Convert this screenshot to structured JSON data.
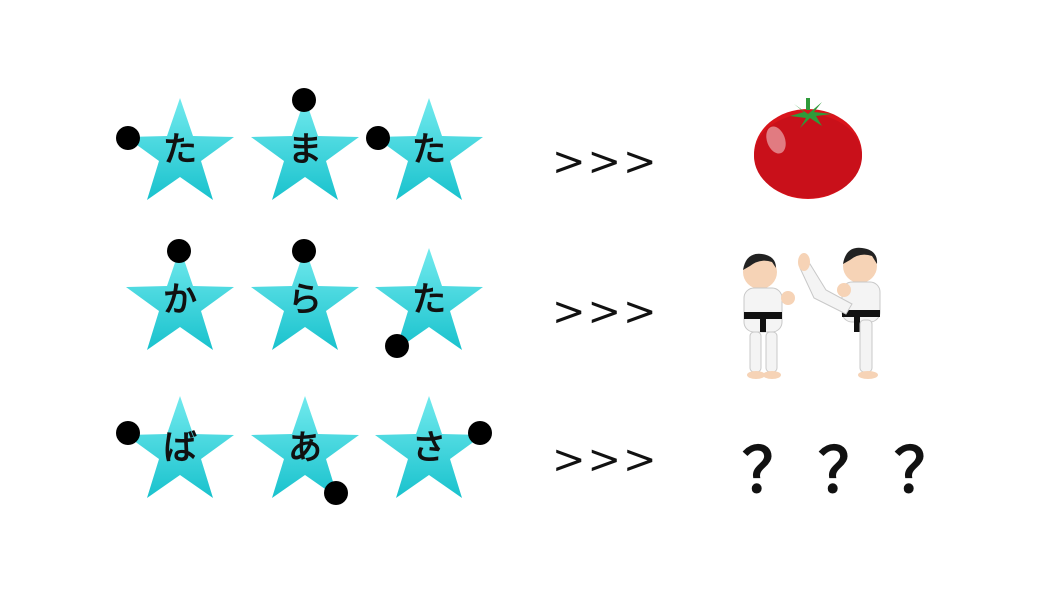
{
  "rows": [
    {
      "stars": [
        {
          "char": "た",
          "dot": "left"
        },
        {
          "char": "ま",
          "dot": "top"
        },
        {
          "char": "た",
          "dot": "left"
        }
      ],
      "arrow": ">>>",
      "answer_icon": "tomato-icon"
    },
    {
      "stars": [
        {
          "char": "か",
          "dot": "top"
        },
        {
          "char": "ら",
          "dot": "top"
        },
        {
          "char": "た",
          "dot": "bottom-left"
        }
      ],
      "arrow": ">>>",
      "answer_icon": "karate-fighters-icon"
    },
    {
      "stars": [
        {
          "char": "ば",
          "dot": "left"
        },
        {
          "char": "あ",
          "dot": "bottom-right"
        },
        {
          "char": "さ",
          "dot": "right"
        }
      ],
      "arrow": ">>>",
      "answer_text": "？？？"
    }
  ],
  "colors": {
    "star_top": "#6ee8ec",
    "star_bottom": "#1cc4cf",
    "dot": "#000000",
    "tomato": "#d9141b",
    "leaf": "#2f9a3a"
  }
}
